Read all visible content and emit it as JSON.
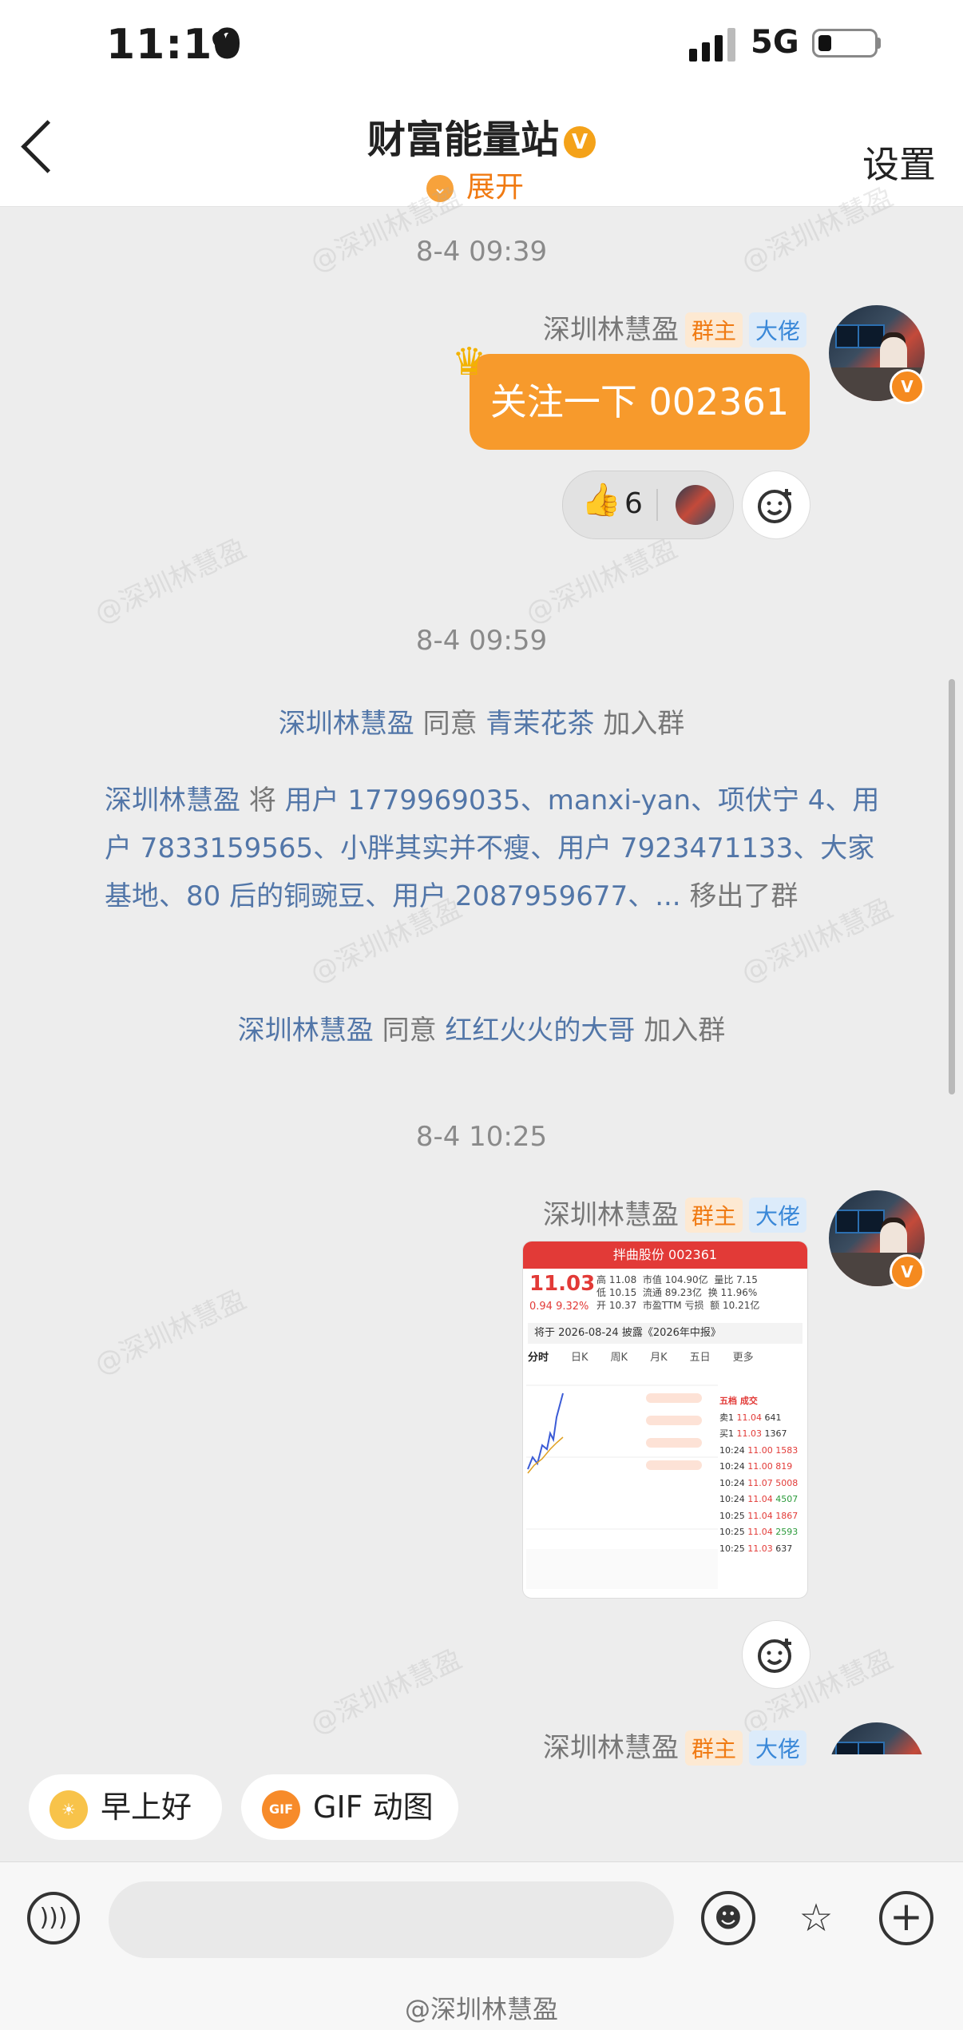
{
  "status_bar": {
    "time": "11:10",
    "heart": "♥",
    "network": "5G"
  },
  "header": {
    "title": "财富能量站",
    "title_badge": "V",
    "expand_label": "展开",
    "settings_label": "设置"
  },
  "messages": [
    {
      "timestamp": "8-4 09:39",
      "sender": "深圳林慧盈",
      "tag_owner": "群主",
      "tag_vip": "大佬",
      "text": "关注一下 002361",
      "reaction_count": "6"
    },
    {
      "timestamp": "8-4 09:59"
    },
    {
      "timestamp": "8-4 10:25",
      "sender": "深圳林慧盈",
      "tag_owner": "群主",
      "tag_vip": "大佬"
    },
    {
      "sender": "深圳林慧盈",
      "tag_owner": "群主",
      "tag_vip": "大佬"
    }
  ],
  "system": {
    "join1": {
      "user": "深圳林慧盈",
      "verb": "同意",
      "target": "青茉花茶",
      "suffix": "加入群"
    },
    "removed": {
      "actor": "深圳林慧盈",
      "verb": "将",
      "users": "用户 1779969035、manxi-yan、项伏宁 4、用户 7833159565、小胖其实并不瘦、用户 7923471133、大家基地、80 后的铜豌豆、用户 2087959677、...",
      "suffix": "移出了群"
    },
    "join2": {
      "user": "深圳林慧盈",
      "verb": "同意",
      "target": "红红火火的大哥",
      "suffix": "加入群"
    }
  },
  "stock_image": {
    "header": "拌曲股份",
    "code": "002361",
    "price": "11.03",
    "change": "0.94  9.32%",
    "quotes": [
      [
        "高",
        "11.08",
        "市值",
        "104.90亿",
        "量比",
        "7.15"
      ],
      [
        "低",
        "10.15",
        "流通",
        "89.23亿",
        "换",
        "11.96%"
      ],
      [
        "开",
        "10.37",
        "市盈TTM",
        "亏损",
        "额",
        "10.21亿"
      ]
    ],
    "notice": "将于 2026-08-24 披露《2026年中报》",
    "tabs": [
      "分时",
      "日K",
      "周K",
      "月K",
      "五日",
      "更多"
    ],
    "book_title": "五档  成交",
    "book": [
      [
        "卖1",
        "11.04",
        "641"
      ],
      [
        "买1",
        "11.03",
        "1367"
      ],
      [
        "10:24",
        "11.00",
        "1583"
      ],
      [
        "10:24",
        "11.00",
        "819"
      ],
      [
        "10:24",
        "11.07",
        "5008"
      ],
      [
        "10:24",
        "11.04",
        "4507"
      ],
      [
        "10:25",
        "11.04",
        "1867"
      ],
      [
        "10:25",
        "11.04",
        "2593"
      ],
      [
        "10:25",
        "11.03",
        "637"
      ]
    ]
  },
  "quick_replies": [
    {
      "label": "早上好",
      "icon": "sun-emoji-icon"
    },
    {
      "label": "GIF 动图",
      "icon": "gif-icon",
      "icon_text": "GIF"
    }
  ],
  "input": {
    "placeholder": ""
  },
  "watermark": "@深圳林慧盈",
  "colors": {
    "accent": "#f79a2c",
    "owner_tag": "#f07a12",
    "vip_tag": "#3a88d8",
    "link": "#5276a8"
  }
}
